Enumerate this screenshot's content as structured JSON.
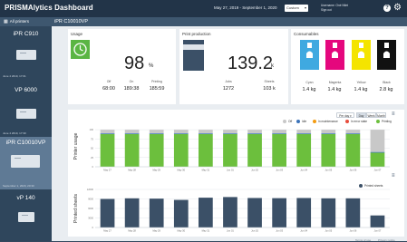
{
  "header": {
    "title": "PRISMAlytics Dashboard",
    "date_range": "May 27, 2019 - September 1, 2020",
    "range_select": "Custom",
    "user_line1": "Username: Oné Ntlet",
    "user_line2": "Sign out"
  },
  "sidebar": {
    "all_label": "All printers",
    "printers": [
      {
        "name": "iPR C910",
        "status": "June 4 2019, 17:01"
      },
      {
        "name": "VP 6000",
        "status": "June 4 2019, 17:30"
      },
      {
        "name": "iPR C10010VP",
        "status": "September 1, 2020, 20:30"
      },
      {
        "name": "vP 140",
        "status": ""
      }
    ]
  },
  "main": {
    "title": "iPR C10010VP",
    "usage": {
      "title": "Usage",
      "value": "98",
      "unit": "%",
      "off_label": "Off",
      "off_val": "68:00",
      "on_label": "On",
      "on_val": "189:38",
      "printing_label": "Printing",
      "printing_val": "185:59"
    },
    "production": {
      "title": "Print production",
      "value": "139.2",
      "unit": "k",
      "jobs_label": "Jobs",
      "jobs_val": "1272",
      "sheets_label": "Sheets",
      "sheets_val": "103 k"
    },
    "consumables": {
      "title": "Consumables",
      "items": [
        {
          "label": "Cyan",
          "value": "1.4 kg",
          "color": "#3fa9e0",
          "fill": 0.6
        },
        {
          "label": "Magenta",
          "value": "1.4 kg",
          "color": "#e5077d",
          "fill": 0.6
        },
        {
          "label": "Yellow",
          "value": "1.4 kg",
          "color": "#f4e400",
          "fill": 0.6
        },
        {
          "label": "Black",
          "value": "2.8 kg",
          "color": "#111111",
          "fill": 0.7
        }
      ]
    },
    "chart_controls": {
      "select": "Per day",
      "seg1": "Day",
      "seg2": "Week",
      "seg3": "Month"
    }
  },
  "chart_data": [
    {
      "type": "bar",
      "ylabel": "Printer usage",
      "categories": [
        "May 27",
        "May 28",
        "May 29",
        "May 30",
        "May 31",
        "Jun 01",
        "Jun 02",
        "Jun 03",
        "Jun 04",
        "Jun 05",
        "Jun 06",
        "Jun 07"
      ],
      "series": [
        {
          "name": "Off",
          "color": "#c8c8c8",
          "values": [
            10,
            10,
            10,
            10,
            10,
            10,
            10,
            10,
            10,
            10,
            10,
            60
          ]
        },
        {
          "name": "Idle",
          "color": "#3b73b9",
          "values": [
            2,
            2,
            2,
            2,
            2,
            2,
            2,
            2,
            2,
            2,
            2,
            2
          ]
        },
        {
          "name": "In maintenance",
          "color": "#f39c12",
          "values": [
            0,
            0,
            0,
            0,
            0,
            0,
            0,
            0,
            0,
            0,
            0,
            0
          ]
        },
        {
          "name": "In error state",
          "color": "#e74c3c",
          "values": [
            0,
            0,
            0,
            0,
            0,
            0,
            0,
            0,
            0,
            0,
            0,
            0
          ]
        },
        {
          "name": "Printing",
          "color": "#6cbf3d",
          "values": [
            88,
            88,
            88,
            88,
            88,
            88,
            88,
            88,
            88,
            88,
            88,
            38
          ]
        }
      ],
      "ylim": [
        0,
        110
      ],
      "yticks": [
        0,
        25,
        50,
        75,
        100
      ]
    },
    {
      "type": "bar",
      "ylabel": "Printed sheets",
      "categories": [
        "May 27",
        "May 28",
        "May 29",
        "May 30",
        "May 31",
        "Jun 01",
        "Jun 02",
        "Jun 03",
        "Jun 04",
        "Jun 05",
        "Jun 06",
        "Jun 07"
      ],
      "series": [
        {
          "name": "Printed sheets",
          "color": "#3b5067",
          "values": [
            9000,
            9200,
            9100,
            8700,
            9400,
            9600,
            9300,
            9250,
            9300,
            9200,
            9200,
            3800
          ]
        }
      ],
      "ylim": [
        0,
        12000
      ],
      "yticks": [
        0,
        3000,
        6000,
        9000,
        12000
      ]
    }
  ],
  "footer": {
    "terms": "Terms of use",
    "privacy": "Privacy notice"
  }
}
